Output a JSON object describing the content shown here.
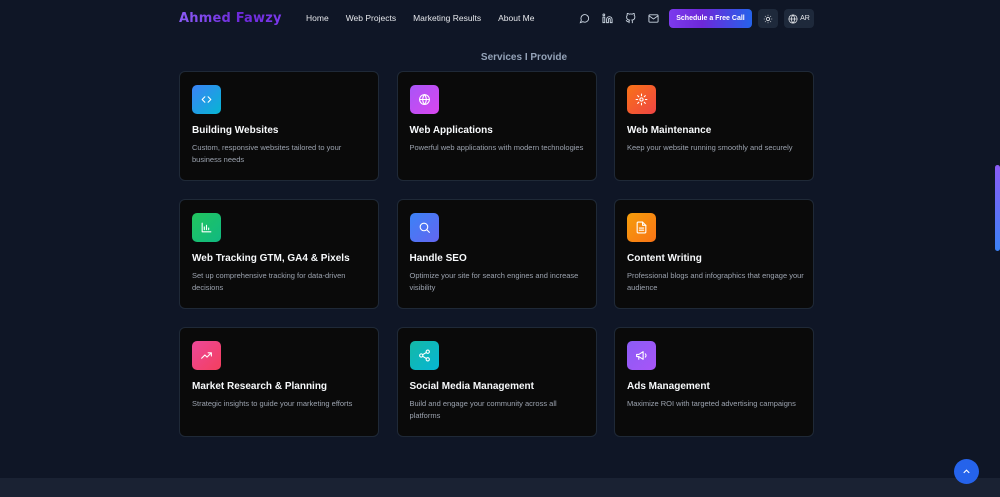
{
  "brand": {
    "name": "Ahmed Fawzy"
  },
  "nav": {
    "items": [
      {
        "label": "Home"
      },
      {
        "label": "Web Projects"
      },
      {
        "label": "Marketing Results"
      },
      {
        "label": "About Me"
      }
    ]
  },
  "header_icons": [
    "whatsapp-icon",
    "linkedin-icon",
    "github-icon",
    "mail-icon"
  ],
  "cta": {
    "label": "Schedule a Free Call"
  },
  "theme_toggle": {
    "icon": "sun-icon"
  },
  "language": {
    "label": "AR",
    "icon": "globe-icon"
  },
  "services": {
    "title": "Services I Provide",
    "cards": [
      {
        "title": "Building Websites",
        "desc": "Custom, responsive websites tailored to your business needs",
        "icon": "code-icon",
        "color": "#3b82f6"
      },
      {
        "title": "Web Applications",
        "desc": "Powerful web applications with modern technologies",
        "icon": "globe-icon",
        "color": "#a855f7"
      },
      {
        "title": "Web Maintenance",
        "desc": "Keep your website running smoothly and securely",
        "icon": "gear-icon",
        "color": "#f97316"
      },
      {
        "title": "Web Tracking GTM, GA4 & Pixels",
        "desc": "Set up comprehensive tracking for data-driven decisions",
        "icon": "bar-chart-icon",
        "color": "#22c55e"
      },
      {
        "title": "Handle SEO",
        "desc": "Optimize your site for search engines and increase visibility",
        "icon": "search-icon",
        "color": "#3b82f6"
      },
      {
        "title": "Content Writing",
        "desc": "Professional blogs and infographics that engage your audience",
        "icon": "document-icon",
        "color": "#f59e0b"
      },
      {
        "title": "Market Research & Planning",
        "desc": "Strategic insights to guide your marketing efforts",
        "icon": "trending-up-icon",
        "color": "#ec4899"
      },
      {
        "title": "Social Media Management",
        "desc": "Build and engage your community across all platforms",
        "icon": "share-icon",
        "color": "#14b8a6"
      },
      {
        "title": "Ads Management",
        "desc": "Maximize ROI with targeted advertising campaigns",
        "icon": "megaphone-icon",
        "color": "#8b5cf6"
      }
    ]
  },
  "scroll_to_top": {
    "icon": "chevron-up-icon"
  }
}
